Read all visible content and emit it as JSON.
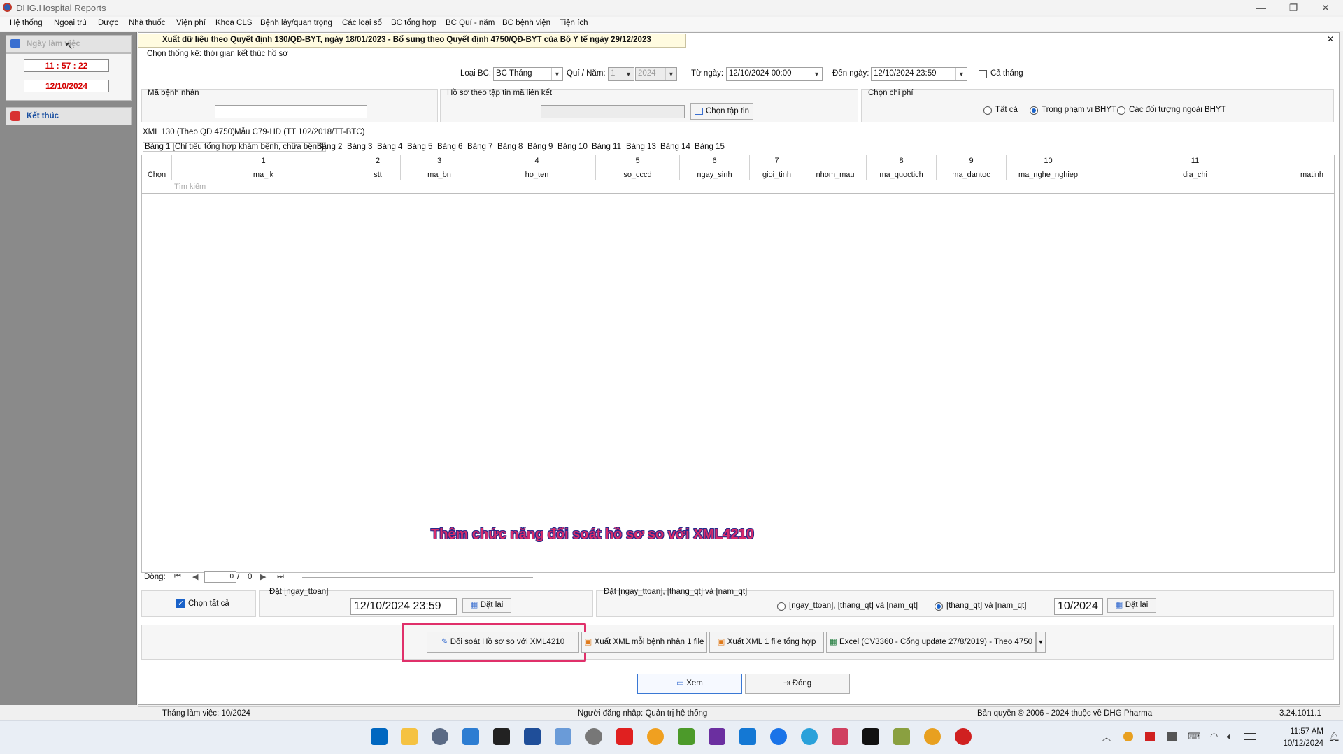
{
  "window": {
    "title": "DHG.Hospital Reports",
    "min_glyph": "—",
    "max_glyph": "❐",
    "close_glyph": "✕"
  },
  "menu": [
    "Hệ thống",
    "Ngoại trú",
    "Dược",
    "Nhà thuốc",
    "Viện phí",
    "Khoa CLS",
    "Bệnh lây/quan trọng",
    "Các loại sổ",
    "BC tổng hợp",
    "BC Quí - năm",
    "BC bệnh viện",
    "Tiện ích"
  ],
  "left": {
    "workday_label": "Ngày làm việc",
    "time": "11 : 57 : 22",
    "date": "12/10/2024",
    "end_label": "Kết thúc"
  },
  "header": {
    "title": "Xuất dữ liệu theo Quyết định 130/QĐ-BYT, ngày 18/01/2023 - Bổ sung theo Quyết định 4750/QĐ-BYT của Bộ Y tế ngày 29/12/2023",
    "close_glyph": "✕"
  },
  "filters": {
    "stat_label": "Chọn thống kê: thời gian kết thúc hồ sơ",
    "report_type_label": "Loại BC:",
    "report_type": "BC Tháng",
    "quarter_year_label": "Quí / Năm:",
    "quarter": "1",
    "year": "2024",
    "from_label": "Từ ngày:",
    "from": "12/10/2024 00:00",
    "to_label": "Đến ngày:",
    "to": "12/10/2024 23:59",
    "whole_month": "Cả tháng",
    "patient_code_label": "Mã bệnh nhân",
    "file_label": "Hồ sơ theo tập tin mã liên kết",
    "choose_file": "Chọn tập tin",
    "cost_label": "Chọn chi phí",
    "cost_options": [
      "Tất cả",
      "Trong phạm vi BHYT",
      "Các đối tượng ngoài BHYT"
    ]
  },
  "tabs_top": [
    "XML 130 (Theo QĐ 4750)",
    "Mẫu C79-HD (TT 102/2018/TT-BTC)"
  ],
  "tabs_tables": [
    "Bảng 1 [Chỉ tiêu tổng hợp khám bệnh, chữa bệnh]",
    "Bảng 2",
    "Bảng 3",
    "Bảng 4",
    "Bảng 5",
    "Bảng 6",
    "Bảng 7",
    "Bảng 8",
    "Bảng 9",
    "Bảng 10",
    "Bảng 11",
    "Bảng 13",
    "Bảng 14",
    "Bảng 15"
  ],
  "grid": {
    "columns": [
      {
        "num": "",
        "name": "Chọn"
      },
      {
        "num": "1",
        "name": "ma_lk"
      },
      {
        "num": "2",
        "name": "stt"
      },
      {
        "num": "3",
        "name": "ma_bn"
      },
      {
        "num": "4",
        "name": "ho_ten"
      },
      {
        "num": "5",
        "name": "so_cccd"
      },
      {
        "num": "6",
        "name": "ngay_sinh"
      },
      {
        "num": "7",
        "name": "gioi_tinh"
      },
      {
        "num": "",
        "name": "nhom_mau"
      },
      {
        "num": "8",
        "name": "ma_quoctich"
      },
      {
        "num": "9",
        "name": "ma_dantoc"
      },
      {
        "num": "10",
        "name": "ma_nghe_nghiep"
      },
      {
        "num": "11",
        "name": "dia_chi"
      },
      {
        "num": "",
        "name": "matinh"
      }
    ],
    "search_placeholder": "Tìm kiếm",
    "annotation": "Thêm chức năng đối soát hồ sơ so với XML4210"
  },
  "pager": {
    "label": "Dòng:",
    "current": "0",
    "sep": "/",
    "total": "0"
  },
  "bottom": {
    "select_all": "Chọn tất cả",
    "set_date_label": "Đặt [ngay_ttoan]",
    "set_date_value": "12/10/2024 23:59",
    "reset1": "Đặt lại",
    "set2_label": "Đặt  [ngay_ttoan], [thang_qt] và [nam_qt]",
    "opt_a": "[ngay_ttoan], [thang_qt] và [nam_qt]",
    "opt_b": "[thang_qt] và [nam_qt]",
    "month_value": "10/2024",
    "reset2": "Đặt lại",
    "reconcile": "Đối soát Hồ sơ so với XML4210",
    "export_each": "Xuất XML mỗi bệnh nhân 1 file",
    "export_one": "Xuất XML 1 file tổng hợp",
    "excel": "Excel (CV3360 - Cổng update 27/8/2019) - Theo 4750",
    "view": "Xem",
    "close": "Đóng"
  },
  "status": {
    "month": "Tháng làm việc: 10/2024",
    "user": "Người đăng nhập: Quản trị hệ thống",
    "copyright": "Bản quyền © 2006 - 2024 thuộc về DHG Pharma",
    "version": "3.24.1011.1"
  },
  "taskbar": {
    "time": "11:57 AM",
    "date": "10/12/2024",
    "brand_color": "#0067c0",
    "highlight_color": "#e0306a"
  }
}
